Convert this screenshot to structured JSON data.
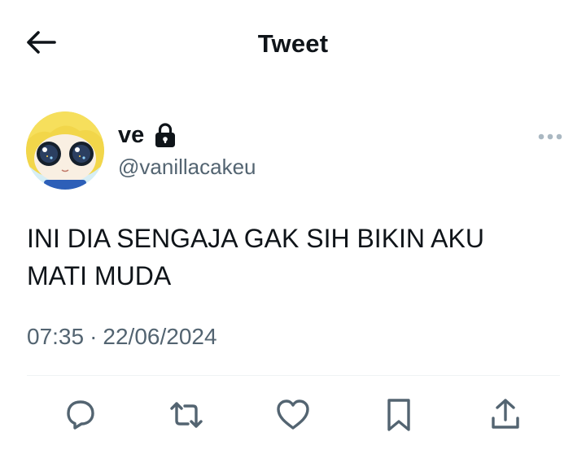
{
  "header": {
    "title": "Tweet",
    "back_icon": "arrow-left-icon"
  },
  "author": {
    "display_name": "ve",
    "handle": "@vanillacakeu",
    "protected_icon": "lock-icon",
    "avatar": "avatar-cartoon-girl-blonde-big-eyes"
  },
  "more_icon": "more-horizontal-icon",
  "tweet": {
    "text": "INI DIA SENGAJA GAK SIH BIKIN AKU MATI MUDA",
    "time": "07:35",
    "separator": "·",
    "date": "22/06/2024"
  },
  "actions": [
    {
      "name": "reply",
      "icon": "reply-icon"
    },
    {
      "name": "retweet",
      "icon": "retweet-icon"
    },
    {
      "name": "like",
      "icon": "heart-icon"
    },
    {
      "name": "bookmark",
      "icon": "bookmark-icon"
    },
    {
      "name": "share",
      "icon": "share-icon"
    }
  ],
  "colors": {
    "text_primary": "#0f1419",
    "text_secondary": "#536471",
    "icon_gray": "#536471",
    "divider": "#eff3f4"
  }
}
